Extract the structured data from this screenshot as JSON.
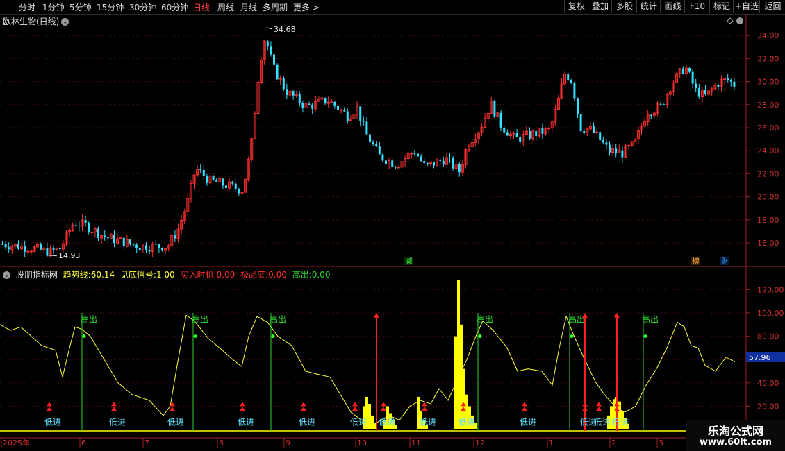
{
  "toolbar": {
    "periods": [
      "分时",
      "1分钟",
      "5分钟",
      "15分钟",
      "30分钟",
      "60分钟",
      "日线",
      "周线",
      "月线",
      "多周期",
      "更多 >"
    ],
    "active_period": "日线",
    "buttons": [
      "复权",
      "叠加",
      "多股",
      "统计",
      "画线",
      "F10",
      "标记",
      "+自选",
      "返回"
    ]
  },
  "main_chart": {
    "title": "欧林生物(日线)",
    "high_label": "34.68",
    "low_label": "14.93",
    "event_jian": "减",
    "event_bang": "榜",
    "event_cai": "财",
    "y_ticks": [
      "34.00",
      "32.00",
      "30.00",
      "28.00",
      "26.00",
      "24.00",
      "22.00",
      "20.00",
      "18.00",
      "16.00"
    ],
    "colors": {
      "up": "#ff3030",
      "down": "#33e0ff"
    }
  },
  "indicator": {
    "name": "股朋指标网",
    "trend_label": "趋势线:",
    "trend_value": "60.14",
    "signal_label": "见底信号:",
    "signal_value": "1.00",
    "buy_label": "买入时机:",
    "buy_value": "0.00",
    "bottom_label": "极品底:",
    "bottom_value": "0.00",
    "sell_label": "高出:",
    "sell_value": "0.00",
    "current_value": "57.96",
    "y_ticks": [
      "120.00",
      "100.00",
      "80.00",
      "60.00",
      "40.00",
      "20.00"
    ],
    "sell_text": "高出",
    "buy_text": "低进",
    "colors": {
      "trend": "#ffff40",
      "signal": "#ffff00",
      "buy": "#ff2020",
      "sell": "#30d030",
      "labels": "#5fe0ff"
    }
  },
  "x_axis": {
    "labels": [
      "2025年",
      "6",
      "7",
      "8",
      "9",
      "10",
      "11",
      "12",
      "1",
      "2",
      "3"
    ]
  },
  "watermark": {
    "line1": "乐淘公式网",
    "line2": "www.60lt.com"
  }
}
